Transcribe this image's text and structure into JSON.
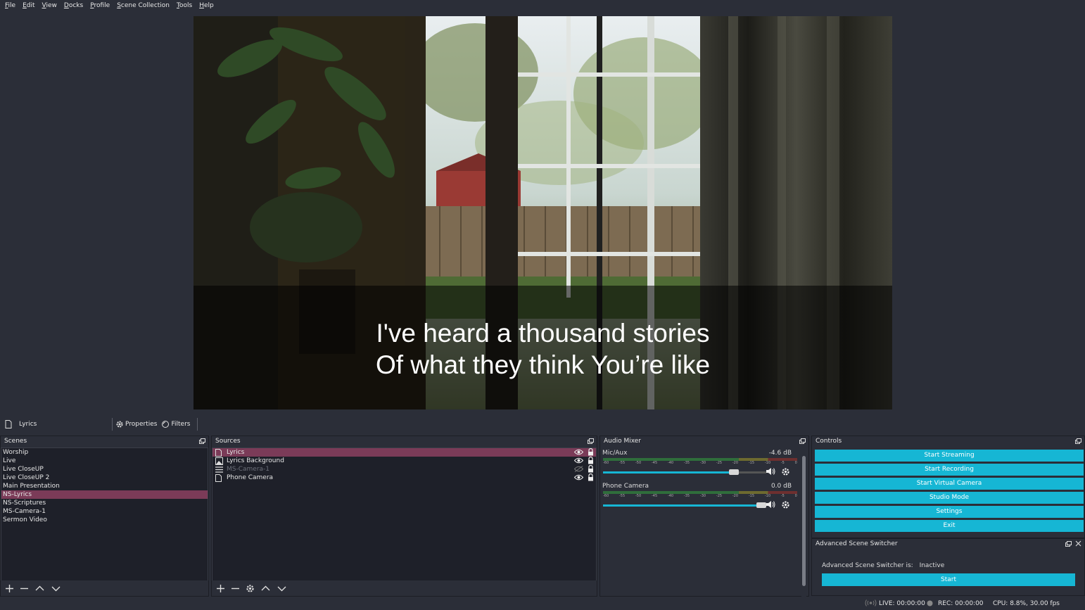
{
  "menubar": {
    "items": [
      {
        "first": "F",
        "rest": "ile"
      },
      {
        "first": "E",
        "rest": "dit"
      },
      {
        "first": "V",
        "rest": "iew"
      },
      {
        "first": "D",
        "rest": "ocks"
      },
      {
        "first": "P",
        "rest": "rofile"
      },
      {
        "first": "S",
        "rest": "cene Collection"
      },
      {
        "first": "T",
        "rest": "ools"
      },
      {
        "first": "H",
        "rest": "elp"
      }
    ]
  },
  "preview": {
    "lyrics": "I've heard a thousand stories\nOf what they think You’re like"
  },
  "scenebar": {
    "current_source": "Lyrics",
    "properties_label": "Properties",
    "filters_label": "Filters"
  },
  "scenes": {
    "title": "Scenes",
    "items": [
      "Worship",
      "Live",
      "Live CloseUP",
      "Live CloseUP 2",
      "Main Presentation",
      "NS-Lyrics",
      "NS-Scriptures",
      "MS-Camera-1",
      "Sermon Video"
    ],
    "selected_index": 5
  },
  "sources": {
    "title": "Sources",
    "items": [
      {
        "label": "Lyrics",
        "icon": "text-icon",
        "visible": true
      },
      {
        "label": "Lyrics Background",
        "icon": "image-icon",
        "visible": true
      },
      {
        "label": "MS-Camera-1",
        "icon": "scene-icon",
        "visible": false
      },
      {
        "label": "Phone Camera",
        "icon": "text-icon",
        "visible": true
      }
    ]
  },
  "mixer": {
    "title": "Audio Mixer",
    "ticks": [
      "-60",
      "-55",
      "-50",
      "-45",
      "-40",
      "-35",
      "-30",
      "-25",
      "-20",
      "-15",
      "-10",
      "-5",
      "0"
    ],
    "channels": [
      {
        "name": "Mic/Aux",
        "db": "-4.6 dB",
        "level": 0.8
      },
      {
        "name": "Phone Camera",
        "db": "0.0 dB",
        "level": 1.0
      }
    ]
  },
  "controls": {
    "title": "Controls",
    "buttons": [
      "Start Streaming",
      "Start Recording",
      "Start Virtual Camera",
      "Studio Mode",
      "Settings",
      "Exit"
    ]
  },
  "switcher": {
    "title": "Advanced Scene Switcher",
    "status_label": "Advanced Scene Switcher is:",
    "status_value": "Inactive",
    "start_label": "Start"
  },
  "status": {
    "live": "LIVE: 00:00:00",
    "rec": "REC: 00:00:00",
    "cpu": "CPU: 8.8%, 30.00 fps"
  },
  "colors": {
    "accent": "#16b6d4",
    "selection": "#7b3b58",
    "background": "#2b2e38"
  }
}
